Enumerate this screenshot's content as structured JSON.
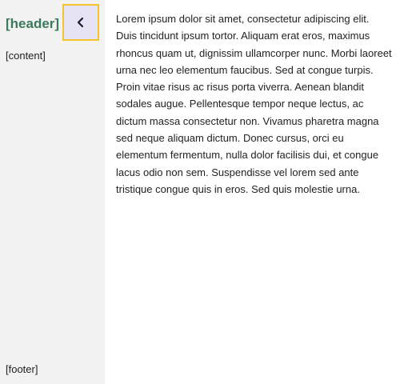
{
  "sidebar": {
    "header": "[header]",
    "content": "[content]",
    "footer": "[footer]",
    "collapse_button": {
      "icon": "chevron-left-icon",
      "border_color": "#f4c430",
      "background_color": "#e6e4f4"
    },
    "background_color": "#f2f2f2",
    "header_color": "#3a7a5a"
  },
  "main": {
    "text": "Lorem ipsum dolor sit amet, consectetur adipiscing elit. Duis tincidunt ipsum tortor. Aliquam erat eros, maximus rhoncus quam ut, dignissim ullamcorper nunc. Morbi laoreet urna nec leo elementum faucibus. Sed at congue turpis. Proin vitae risus ac risus porta viverra. Aenean blandit sodales augue. Pellentesque tempor neque lectus, ac dictum massa consectetur non. Vivamus pharetra magna sed neque aliquam dictum. Donec cursus, orci eu elementum fermentum, nulla dolor facilisis dui, et congue lacus odio non sem. Suspendisse vel lorem sed ante tristique congue quis in eros. Sed quis molestie urna."
  }
}
